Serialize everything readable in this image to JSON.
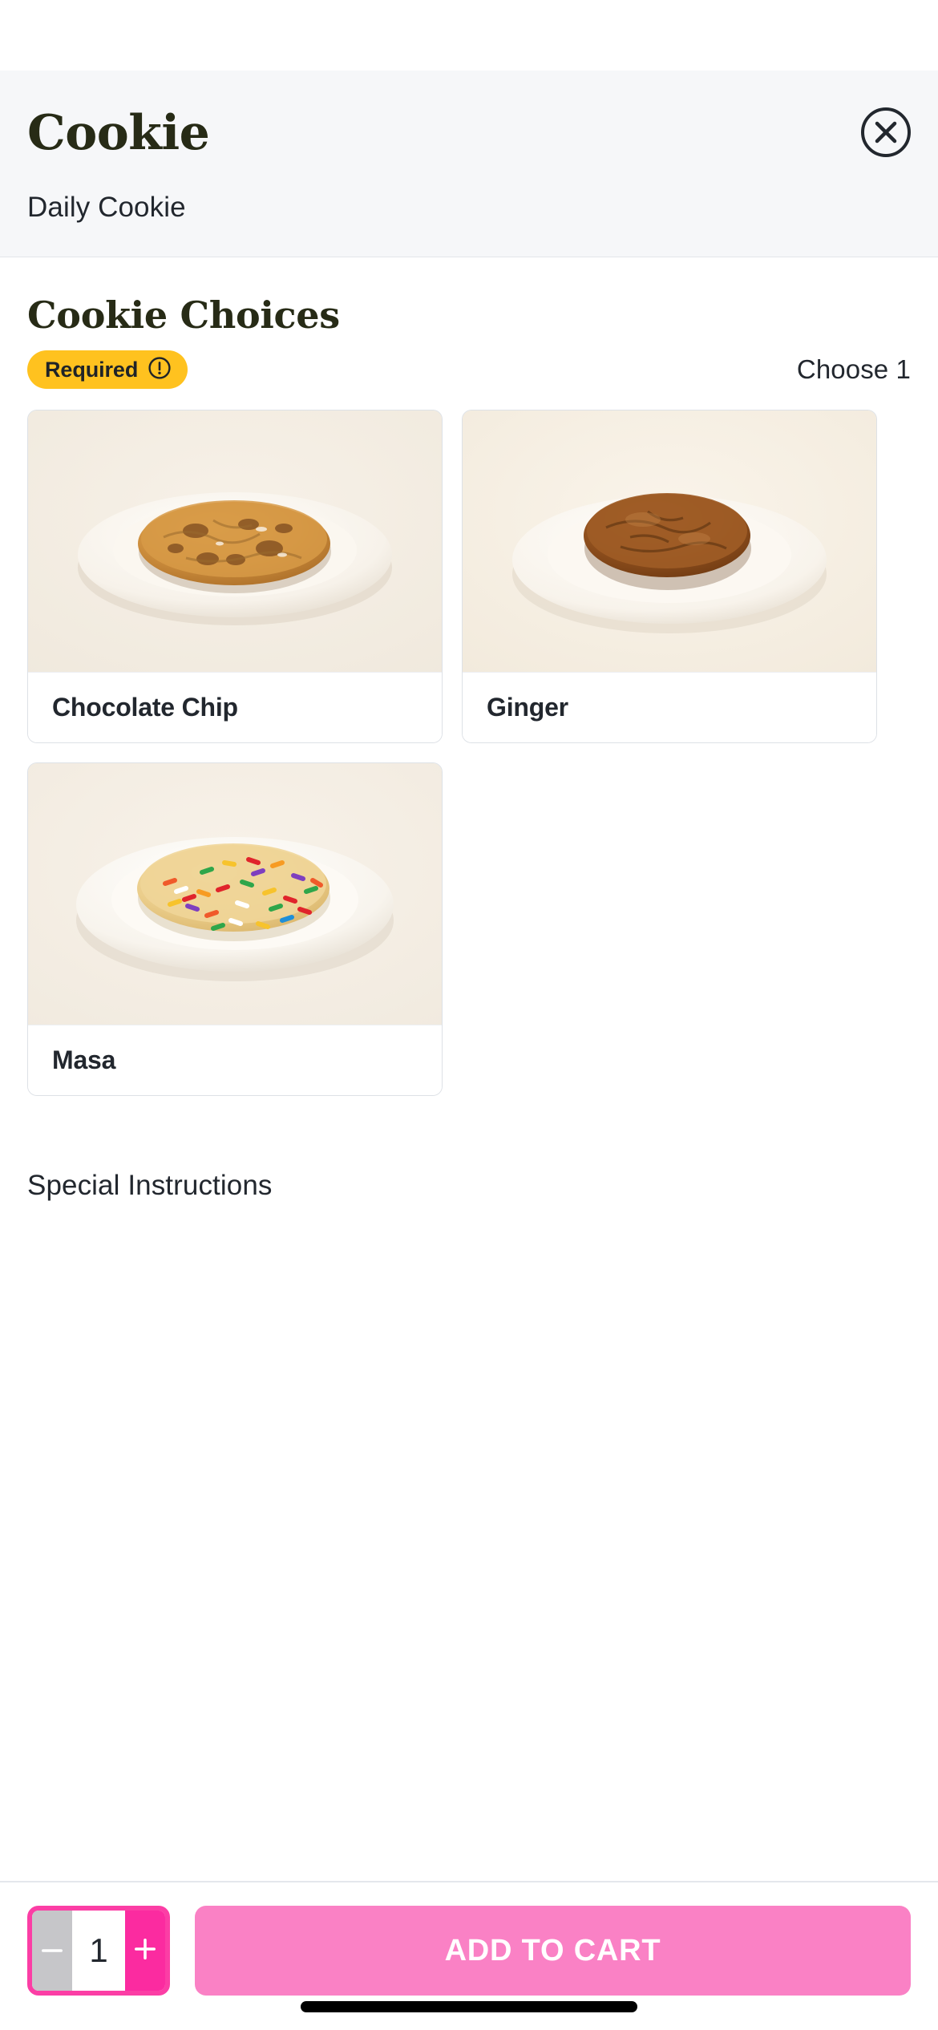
{
  "theme": {
    "header_bg": "#F6F7F9",
    "title_color": "#272B16",
    "required_badge_bg": "#FFC21F",
    "accent_pink": "#FB2BA0",
    "cta_pink": "#FA81C5",
    "disabled_gray": "#C6C6C9",
    "card_border": "#DDE1E6",
    "photo_bg": "#F4EEE5"
  },
  "header": {
    "title": "Cookie",
    "subtitle": "Daily Cookie",
    "close_icon": "close-circle-icon"
  },
  "group": {
    "title": "Cookie Choices",
    "required_label": "Required",
    "required_icon": "exclamation-circle-icon",
    "choose_text": "Choose 1",
    "options": [
      {
        "label": "Chocolate Chip",
        "image": "chocolate-chip-cookie-on-plate"
      },
      {
        "label": "Ginger",
        "image": "ginger-cookie-on-plate"
      },
      {
        "label": "Masa",
        "image": "masa-sprinkle-cookie-on-plate"
      }
    ]
  },
  "special_instructions": {
    "label": "Special Instructions"
  },
  "action_bar": {
    "decrement_label": "−",
    "quantity": "1",
    "increment_label": "+",
    "add_to_cart_label": "ADD TO CART"
  }
}
